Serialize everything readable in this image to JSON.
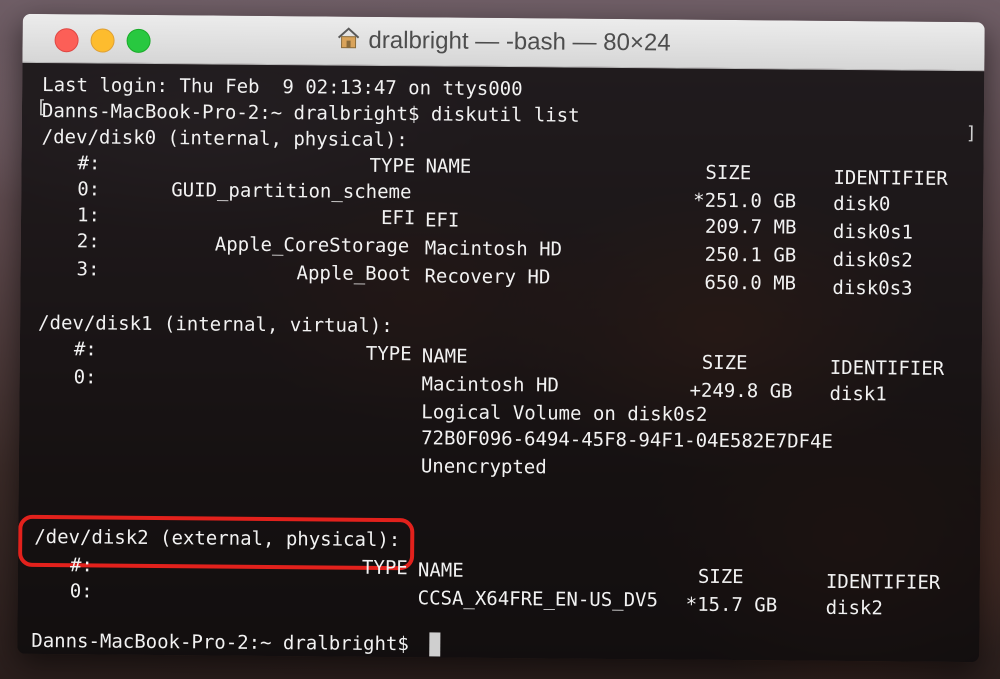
{
  "window": {
    "title": "dralbright — -bash — 80×24"
  },
  "terminal": {
    "last_login": "Last login: Thu Feb  9 02:13:47 on ttys000",
    "prompt_command": "Danns-MacBook-Pro-2:~ dralbright$ diskutil list",
    "disk0": {
      "header": "/dev/disk0 (internal, physical):",
      "cols": {
        "num": "#:",
        "type": "TYPE",
        "name": "NAME",
        "size": "SIZE",
        "identifier": "IDENTIFIER"
      },
      "rows": [
        {
          "num": "0:",
          "type": "GUID_partition_scheme",
          "name": "",
          "size": "*251.0 GB",
          "identifier": "disk0"
        },
        {
          "num": "1:",
          "type": "EFI",
          "name": "EFI",
          "size": "209.7 MB",
          "identifier": "disk0s1"
        },
        {
          "num": "2:",
          "type": "Apple_CoreStorage",
          "name": "Macintosh HD",
          "size": "250.1 GB",
          "identifier": "disk0s2"
        },
        {
          "num": "3:",
          "type": "Apple_Boot",
          "name": "Recovery HD",
          "size": "650.0 MB",
          "identifier": "disk0s3"
        }
      ]
    },
    "disk1": {
      "header": "/dev/disk1 (internal, virtual):",
      "cols": {
        "num": "#:",
        "type": "TYPE",
        "name": "NAME",
        "size": "SIZE",
        "identifier": "IDENTIFIER"
      },
      "row": {
        "num": "0:",
        "name": "Macintosh HD",
        "size": "+249.8 GB",
        "identifier": "disk1"
      },
      "extra": [
        "Logical Volume on disk0s2",
        "72B0F096-6494-45F8-94F1-04E582E7DF4E",
        "Unencrypted"
      ]
    },
    "disk2": {
      "header": "/dev/disk2 (external, physical):",
      "cols": {
        "num": "#:",
        "type": "TYPE",
        "name": "NAME",
        "size": "SIZE",
        "identifier": "IDENTIFIER"
      },
      "row": {
        "num": "0:",
        "name": "CCSA_X64FRE_EN-US_DV5",
        "size": "*15.7 GB",
        "identifier": "disk2"
      }
    },
    "final_prompt": "Danns-MacBook-Pro-2:~ dralbright$"
  },
  "colors": {
    "highlight": "#e2211c",
    "close": "#fc5f57",
    "minimize": "#fdbc2e",
    "maximize": "#28c840"
  }
}
